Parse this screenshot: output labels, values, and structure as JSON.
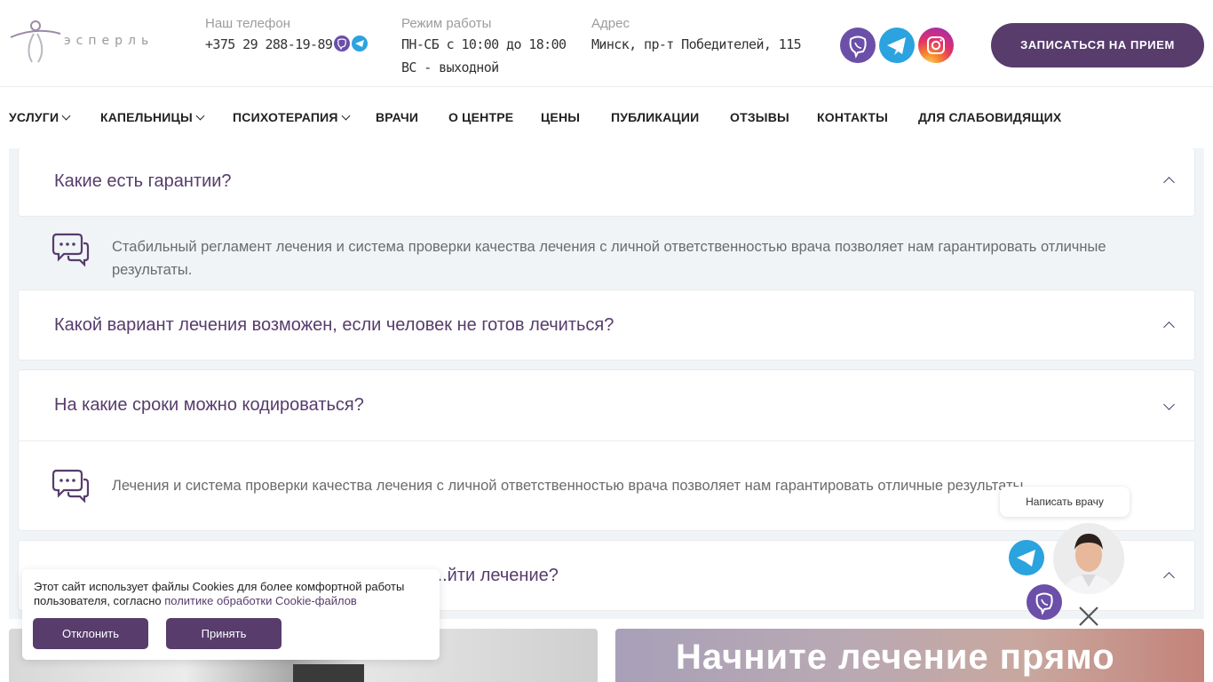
{
  "header": {
    "logo_text": "эсперль",
    "phone_label": "Наш телефон",
    "phone_value": "+375 29 288-19-89",
    "hours_label": "Режим работы",
    "hours_line1": "ПН-СБ с 10:00 до 18:00",
    "hours_line2": "ВС - выходной",
    "address_label": "Адрес",
    "address_value": "Минск, пр-т Победителей, 115",
    "cta_label": "ЗАПИСАТЬСЯ НА ПРИЕМ",
    "socials": [
      "viber-icon",
      "telegram-icon",
      "instagram-icon"
    ]
  },
  "nav": {
    "items": [
      {
        "label": "УСЛУГИ",
        "dropdown": true
      },
      {
        "label": "КАПЕЛЬНИЦЫ",
        "dropdown": true
      },
      {
        "label": "ПСИХОТЕРАПИЯ",
        "dropdown": true
      },
      {
        "label": "ВРАЧИ",
        "dropdown": false
      },
      {
        "label": "О ЦЕНТРЕ",
        "dropdown": false
      },
      {
        "label": "ЦЕНЫ",
        "dropdown": false
      },
      {
        "label": "ПУБЛИКАЦИИ",
        "dropdown": false
      },
      {
        "label": "ОТЗЫВЫ",
        "dropdown": false
      },
      {
        "label": "КОНТАКТЫ",
        "dropdown": false
      },
      {
        "label": "ДЛЯ СЛАБОВИДЯЩИХ",
        "dropdown": false
      }
    ]
  },
  "faq": {
    "items": [
      {
        "question": "Какие есть гарантии?",
        "expanded": true,
        "answer": "Стабильный регламент лечения и система проверки качества лечения с личной ответственностью врача позволяет нам гарантировать отличные результаты."
      },
      {
        "question": "Какой вариант лечения возможен, если человек не готов лечиться?",
        "expanded": false
      },
      {
        "question": "На какие сроки можно кодироваться?",
        "expanded": true,
        "answer": "Лечения и система проверки качества лечения с личной ответственностью врача позволяет нам гарантировать отличные результаты"
      },
      {
        "question": "...йти лечение?",
        "expanded": false
      }
    ]
  },
  "banner": {
    "title": "Начните лечение прямо"
  },
  "cookie": {
    "text": "Этот сайт использует файлы Cookies для более комфортной работы пользователя, согласно ",
    "link": "политике обработки Cookie-файлов",
    "decline_label": "Отклонить",
    "accept_label": "Принять"
  },
  "widget": {
    "write_doctor_label": "Написать врачу"
  },
  "colors": {
    "brand_purple": "#573c6c",
    "telegram": "#2aa3df",
    "viber": "#6b4fa8"
  }
}
